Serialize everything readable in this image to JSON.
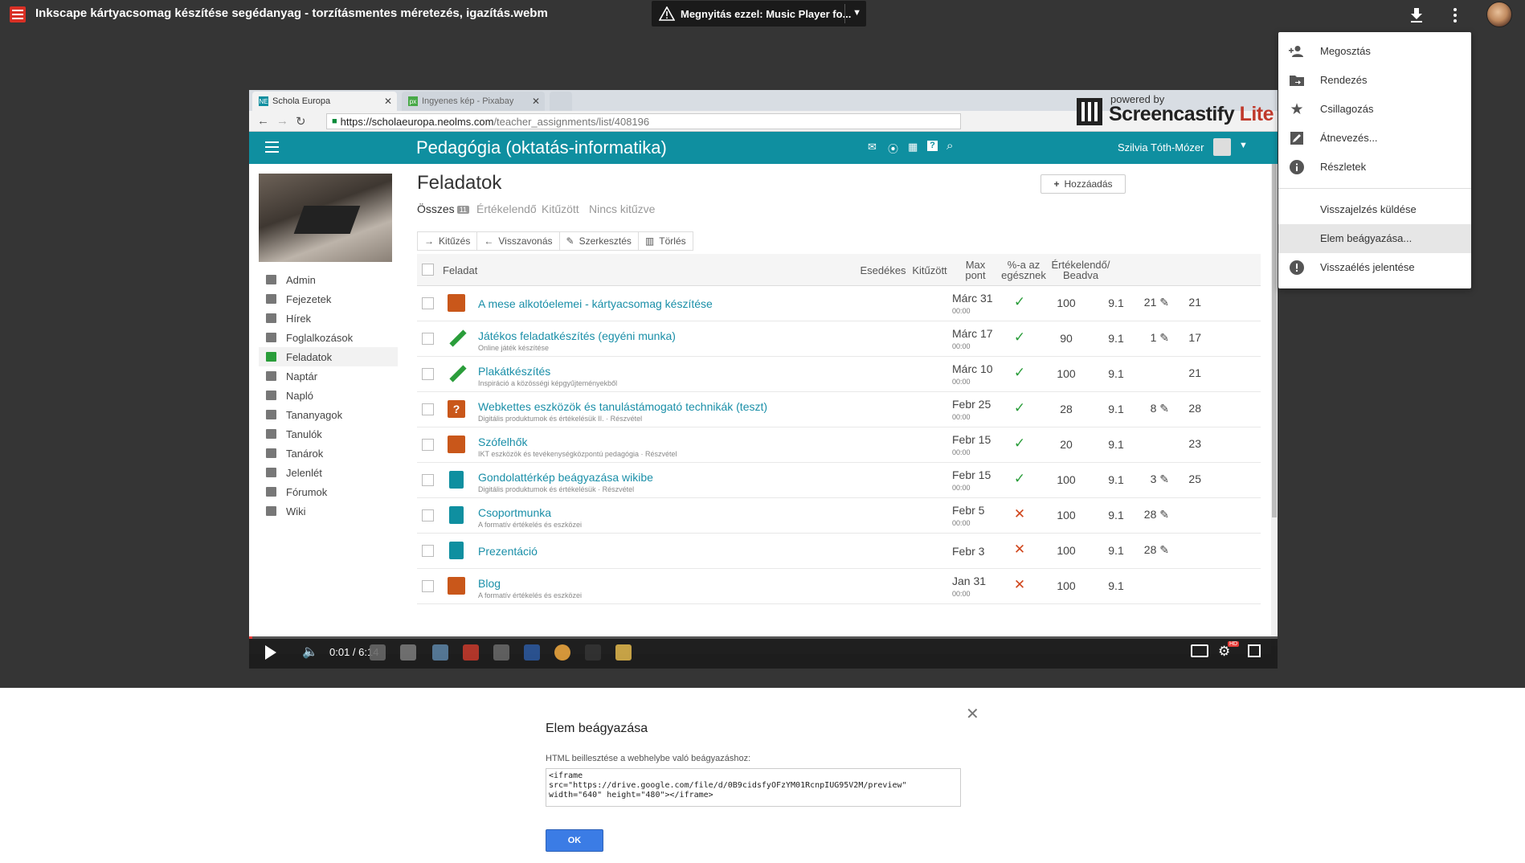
{
  "topbar": {
    "file_title": "Inkscape kártyacsomag készítése segédanyag - torzításmentes méretezés, igazítás.webm",
    "open_with": "Megnyitás ezzel: Music Player fo..."
  },
  "browser": {
    "tabs": [
      {
        "label": "Schola Europa",
        "favicon": "NE"
      },
      {
        "label": "Ingyenes kép - Pixabay",
        "favicon": "px"
      }
    ],
    "url_host": "https://scholaeuropa.neolms.com",
    "url_path": "/teacher_assignments/list/408196",
    "watermark_small": "powered by",
    "watermark_big": "Screencastify",
    "watermark_lite": "Lite"
  },
  "lms": {
    "course_title": "Pedagógia (oktatás-informatika)",
    "user_name": "Szilvia Tóth-Mózer",
    "sidebar": [
      {
        "label": "Admin"
      },
      {
        "label": "Fejezetek"
      },
      {
        "label": "Hírek"
      },
      {
        "label": "Foglalkozások"
      },
      {
        "label": "Feladatok"
      },
      {
        "label": "Naptár"
      },
      {
        "label": "Napló"
      },
      {
        "label": "Tananyagok"
      },
      {
        "label": "Tanulók"
      },
      {
        "label": "Tanárok"
      },
      {
        "label": "Jelenlét"
      },
      {
        "label": "Fórumok"
      },
      {
        "label": "Wiki"
      }
    ],
    "page_title": "Feladatok",
    "add_button": "Hozzáadás",
    "filter_tabs": [
      {
        "label": "Összes",
        "badge": "11"
      },
      {
        "label": "Értékelendő"
      },
      {
        "label": "Kitűzött"
      },
      {
        "label": "Nincs kitűzve"
      }
    ],
    "actions": [
      "Kitűzés",
      "Visszavonás",
      "Szerkesztés",
      "Törlés"
    ],
    "columns": {
      "task": "Feladat",
      "due": "Esedékes",
      "published": "Kitűzött",
      "max_1": "Max",
      "max_2": "pont",
      "pct_1": "%-a az",
      "pct_2": "egésznek",
      "eval_1": "Értékelendő/",
      "eval_2": "Beadva"
    },
    "rows": [
      {
        "title": "A mese alkotóelemei - kártyacsomag készítése",
        "sub": "",
        "due": "Márc 31",
        "time": "00:00",
        "status": "✓",
        "max": "100",
        "pct": "9.1",
        "eval": "21",
        "total": "21"
      },
      {
        "title": "Játékos feladatkészítés (egyéni munka)",
        "sub": "Online játék készítése",
        "due": "Márc 17",
        "time": "00:00",
        "status": "✓",
        "max": "90",
        "pct": "9.1",
        "eval": "1",
        "total": "17"
      },
      {
        "title": "Plakátkészítés",
        "sub": "Inspiráció a közösségi képgyűjteményekből",
        "due": "Márc 10",
        "time": "00:00",
        "status": "✓",
        "max": "100",
        "pct": "9.1",
        "eval": "",
        "total": "21"
      },
      {
        "title": "Webkettes eszközök és tanulástámogató technikák (teszt)",
        "sub": "Digitális produktumok és értékelésük II. · Részvétel",
        "due": "Febr 25",
        "time": "00:00",
        "status": "✓",
        "max": "28",
        "pct": "9.1",
        "eval": "8",
        "total": "28"
      },
      {
        "title": "Szófelhők",
        "sub": "IKT eszközök és tevékenységközpontú pedagógia · Részvétel",
        "due": "Febr 15",
        "time": "00:00",
        "status": "✓",
        "max": "20",
        "pct": "9.1",
        "eval": "",
        "total": "23"
      },
      {
        "title": "Gondolattérkép beágyazása wikibe",
        "sub": "Digitális produktumok és értékelésük · Részvétel",
        "due": "Febr 15",
        "time": "00:00",
        "status": "✓",
        "max": "100",
        "pct": "9.1",
        "eval": "3",
        "total": "25"
      },
      {
        "title": "Csoportmunka",
        "sub": "A formatív értékelés és eszközei",
        "due": "Febr 5",
        "time": "00:00",
        "status": "✕",
        "max": "100",
        "pct": "9.1",
        "eval": "28",
        "total": ""
      },
      {
        "title": "Prezentáció",
        "sub": "",
        "due": "Febr 3",
        "time": "",
        "status": "✕",
        "max": "100",
        "pct": "9.1",
        "eval": "28",
        "total": ""
      },
      {
        "title": "Blog",
        "sub": "A formatív értékelés és eszközei",
        "due": "Jan 31",
        "time": "00:00",
        "status": "✕",
        "max": "100",
        "pct": "9.1",
        "eval": "",
        "total": ""
      }
    ]
  },
  "player": {
    "time": "0:01 / 6:14",
    "progress_fraction": 0.003
  },
  "menu": {
    "items": [
      {
        "label": "Megosztás",
        "icon": "person-add-icon"
      },
      {
        "label": "Rendezés",
        "icon": "folder-move-icon"
      },
      {
        "label": "Csillagozás",
        "icon": "star-icon"
      },
      {
        "label": "Átnevezés...",
        "icon": "edit-icon"
      },
      {
        "label": "Részletek",
        "icon": "info-icon"
      },
      {
        "label": "Visszajelzés küldése",
        "icon": ""
      },
      {
        "label": "Elem beágyazása...",
        "icon": ""
      },
      {
        "label": "Visszaélés jelentése",
        "icon": "report-icon"
      }
    ],
    "highlighted": "Elem beágyazása..."
  },
  "embed_dialog": {
    "title": "Elem beágyazása",
    "label": "HTML beillesztése a webhelybe való beágyazáshoz:",
    "code": "<iframe\nsrc=\"https://drive.google.com/file/d/0B9cidsfyOFzYM01RcnpIUG95V2M/preview\"\nwidth=\"640\" height=\"480\"></iframe>",
    "ok": "OK"
  },
  "colors": {
    "lms_header": "#0f8fa0",
    "link": "#1a8fa8",
    "check": "#2a9d3a",
    "cross": "#d0451b",
    "ok_button": "#3b7ce5"
  }
}
